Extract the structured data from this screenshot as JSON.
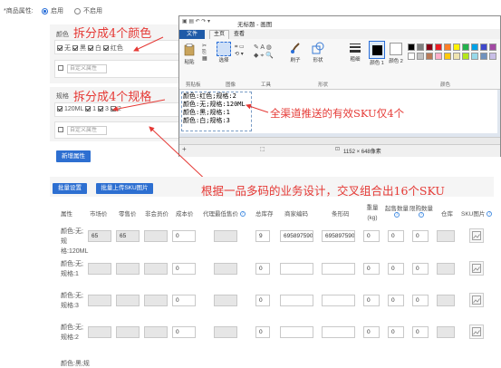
{
  "product_attr": {
    "label": "*商品属性:",
    "opt_on": "启用",
    "opt_off": "不启用"
  },
  "color_panel": {
    "title": "颜色",
    "items": [
      "无",
      "黑",
      "白",
      "红色"
    ],
    "custom_placeholder": "自定义属性",
    "annotation": "拆分成4个颜色"
  },
  "spec_panel": {
    "title": "规格",
    "items": [
      "120ML",
      "1",
      "3",
      "2"
    ],
    "custom_placeholder": "自定义属性",
    "annotation": "拆分成4个规格"
  },
  "add_attr_button": "新增属性",
  "batch_set_button": "批量设置",
  "batch_upload_button": "批量上传SKU图片",
  "cross_annotation": "根据一品多码的业务设计，交叉组合出16个SKU",
  "sku_annotation": "全渠道推送的有效SKU仅4个",
  "paint": {
    "title": "无标题 - 画图",
    "tabs": [
      "文件",
      "主页",
      "查看"
    ],
    "groups": [
      "剪贴板",
      "图像",
      "工具",
      "形状",
      "颜色"
    ],
    "tools": [
      "粘贴",
      "选择",
      "刷子",
      "形状",
      "粗细",
      "颜色 1",
      "颜色 2"
    ],
    "text_lines": [
      "颜色:红色;规格:2",
      "颜色:无;规格:120ML",
      "颜色:黑;规格:1",
      "颜色:白;规格:3"
    ],
    "status": "1152 × 648像素",
    "palette": [
      "#000000",
      "#7f7f7f",
      "#880015",
      "#ed1c24",
      "#ff7f27",
      "#fff200",
      "#22b14c",
      "#00a2e8",
      "#3f48cc",
      "#a349a4",
      "#ffffff",
      "#c3c3c3",
      "#b97a57",
      "#ffaec9",
      "#ffc90e",
      "#efe4b0",
      "#b5e61d",
      "#99d9ea",
      "#7092be",
      "#c8bfe7"
    ]
  },
  "table": {
    "headers": [
      "属性",
      "市场价",
      "零售价",
      "非会员价",
      "成本价",
      "代理最低售价",
      "总库存",
      "商家编码",
      "条形码",
      "重量(kg)",
      "起售数量",
      "限购数量",
      "仓库",
      "SKU图片"
    ],
    "rows": [
      {
        "attr": "颜色:无;规格:120ML",
        "market": "65",
        "retail": "65",
        "cost": "0",
        "stock": "9",
        "code": "6958975906",
        "barcode": "6958975906",
        "weight": "0",
        "min": "0",
        "limit": "0"
      },
      {
        "attr": "颜色:无;规格:1",
        "market": "",
        "retail": "",
        "cost": "0",
        "stock": "0",
        "code": "",
        "barcode": "",
        "weight": "0",
        "min": "0",
        "limit": "0"
      },
      {
        "attr": "颜色:无;规格:3",
        "market": "",
        "retail": "",
        "cost": "0",
        "stock": "0",
        "code": "",
        "barcode": "",
        "weight": "0",
        "min": "0",
        "limit": "0"
      },
      {
        "attr": "颜色:无;规格:2",
        "market": "",
        "retail": "",
        "cost": "0",
        "stock": "0",
        "code": "",
        "barcode": "",
        "weight": "0",
        "min": "0",
        "limit": "0"
      }
    ],
    "partial_row": "颜色:黑;规"
  }
}
